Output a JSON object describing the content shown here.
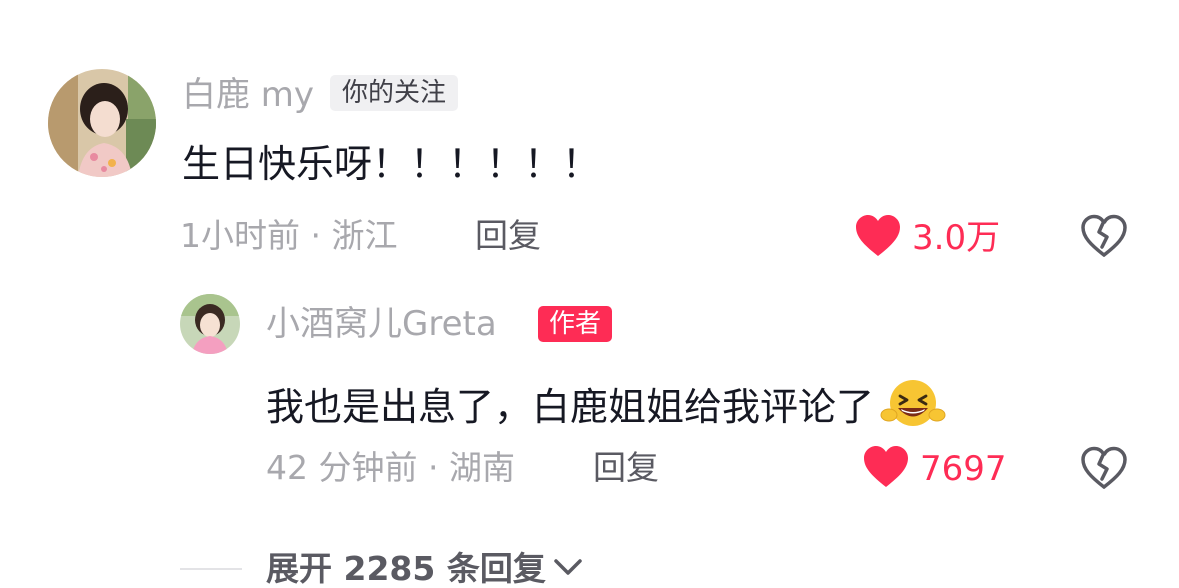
{
  "comments": [
    {
      "username": "白鹿 my",
      "tag": "你的关注",
      "text": "生日快乐呀！！！！！！",
      "time_location": "1小时前 · 浙江",
      "reply_label": "回复",
      "like_count": "3.0万",
      "avatar_icon": "avatar-woman-photo",
      "liked": true
    },
    {
      "username": "小酒窝儿Greta",
      "tag": "作者",
      "text": "我也是出息了，白鹿姐姐给我评论了",
      "emoji_icon": "grinning-squinting-face-icon",
      "time_location": "42 分钟前 · 湖南",
      "reply_label": "回复",
      "like_count": "7697",
      "avatar_icon": "avatar-girl-photo",
      "liked": true
    }
  ],
  "expand_replies": "展开 2285 条回复",
  "colors": {
    "accent": "#fe2c55",
    "muted_text": "#a8a8ad",
    "primary_text": "#161823"
  }
}
